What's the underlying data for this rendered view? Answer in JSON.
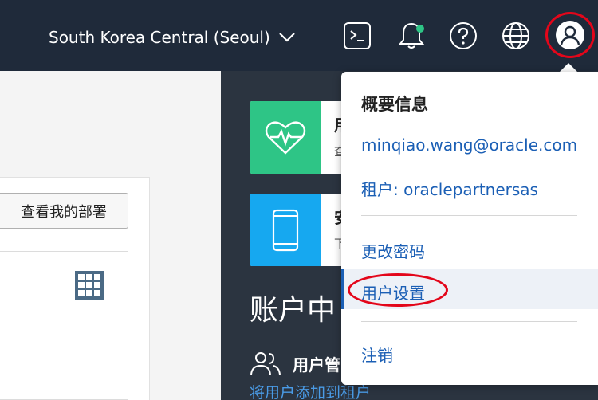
{
  "header": {
    "region_label": "South Korea Central (Seoul)",
    "icons": [
      "terminal-icon",
      "bell-icon",
      "help-icon",
      "globe-icon",
      "user-avatar-icon"
    ],
    "notification_dot_color": "#2ec586"
  },
  "left_panel": {
    "deploy_button_label": "查看我的部署"
  },
  "tiles": [
    {
      "label": "用",
      "sub": "查",
      "icon": "heart-pulse-icon",
      "color": "#2ec586"
    },
    {
      "label": "安",
      "sub": "下",
      "icon": "mobile-phone-icon",
      "color": "#16a8f0"
    }
  ],
  "account": {
    "heading": "账户中",
    "users_label": "用户管",
    "add_user_link": "将用户添加到租户"
  },
  "user_menu": {
    "heading": "概要信息",
    "email": "minqiao.wang@oracle.com",
    "tenant": "租户: oraclepartnersas",
    "change_password": "更改密码",
    "user_settings": "用户设置",
    "sign_out": "注销"
  }
}
